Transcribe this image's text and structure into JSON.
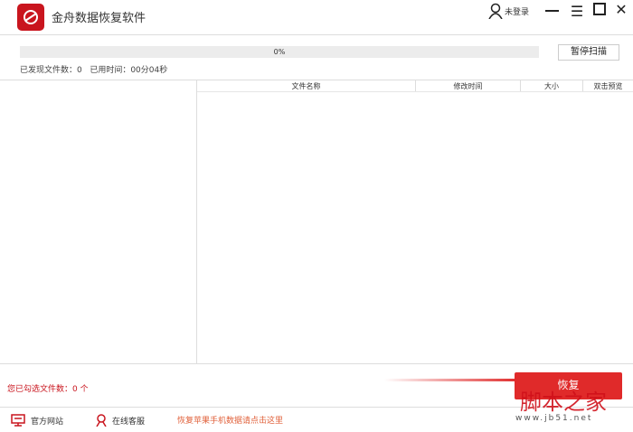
{
  "app": {
    "title": "金舟数据恢复软件"
  },
  "header": {
    "user_label": "未登录"
  },
  "scan": {
    "progress_text": "0%",
    "progress_value": 0,
    "pause_label": "暂停扫描",
    "found_label": "已发现文件数：0",
    "elapsed_label": "已用时间：00分04秒"
  },
  "table": {
    "columns": [
      "文件名称",
      "修改时间",
      "大小",
      "双击预览"
    ]
  },
  "bottom": {
    "selected_label": "您已勾选文件数：0 个",
    "recover_label": "恢复"
  },
  "footer": {
    "website": "官方网站",
    "support": "在线客服",
    "iphone_link": "恢复苹果手机数据请点击这里"
  },
  "watermark": {
    "text": "脚本之家",
    "url": "www.jb51.net"
  },
  "colors": {
    "accent": "#e02a2a"
  }
}
